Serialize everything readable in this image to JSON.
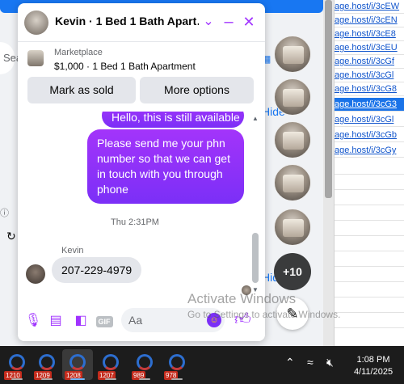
{
  "chat": {
    "title": "Kevin · 1 Bed 1 Bath Apart…",
    "listing": {
      "label": "Marketplace",
      "title": "$1,000 · 1 Bed 1 Bath Apartment"
    },
    "buttons": {
      "mark_sold": "Mark as sold",
      "more_options": "More options"
    },
    "messages": {
      "partial_top": "Hello, this is still available",
      "outgoing": "Please send me your phn number so that we can get in touch with you through phone",
      "timestamp": "Thu 2:31PM",
      "sender": "Kevin",
      "incoming": "207-229-4979"
    },
    "composer": {
      "placeholder": "Aa",
      "gif": "GIF"
    }
  },
  "background": {
    "search_fragment": "Sea",
    "hide_label": "Hide",
    "more_heads": "+10",
    "links": [
      "age.host/i/3cEW",
      "age.host/i/3cEN",
      "age.host/i/3cE8",
      "age.host/i/3cEU",
      "age.host/i/3cGf",
      "age.host/i/3cGl",
      "age.host/i/3cG8",
      "age.host/i/3cG3",
      "age.host/i/3cGl",
      "age.host/i/3cGb",
      "age.host/i/3cGy"
    ],
    "watermark_title": "Activate Windows",
    "watermark_sub": "Go to Settings to activate Windows."
  },
  "taskbar": {
    "apps": [
      {
        "badge": "1210",
        "active": false
      },
      {
        "badge": "1209",
        "active": false
      },
      {
        "badge": "1208",
        "active": true
      },
      {
        "badge": "1207",
        "active": false
      },
      {
        "badge": "989",
        "active": false
      },
      {
        "badge": "978",
        "active": false
      }
    ],
    "time": "1:08 PM",
    "date": "4/11/2025"
  },
  "colors": {
    "accent": "#a033ff",
    "bubble_out": "#7b2ff7",
    "link": "#1155cc",
    "fb_blue": "#1877f2"
  },
  "icons": [
    "chevron-down-icon",
    "minimize-icon",
    "close-icon",
    "microphone-icon",
    "image-icon",
    "sticker-icon",
    "gif-icon",
    "emoji-icon",
    "thumbs-up-icon",
    "compose-icon",
    "wifi-icon",
    "volume-icon",
    "chevron-up-icon"
  ]
}
